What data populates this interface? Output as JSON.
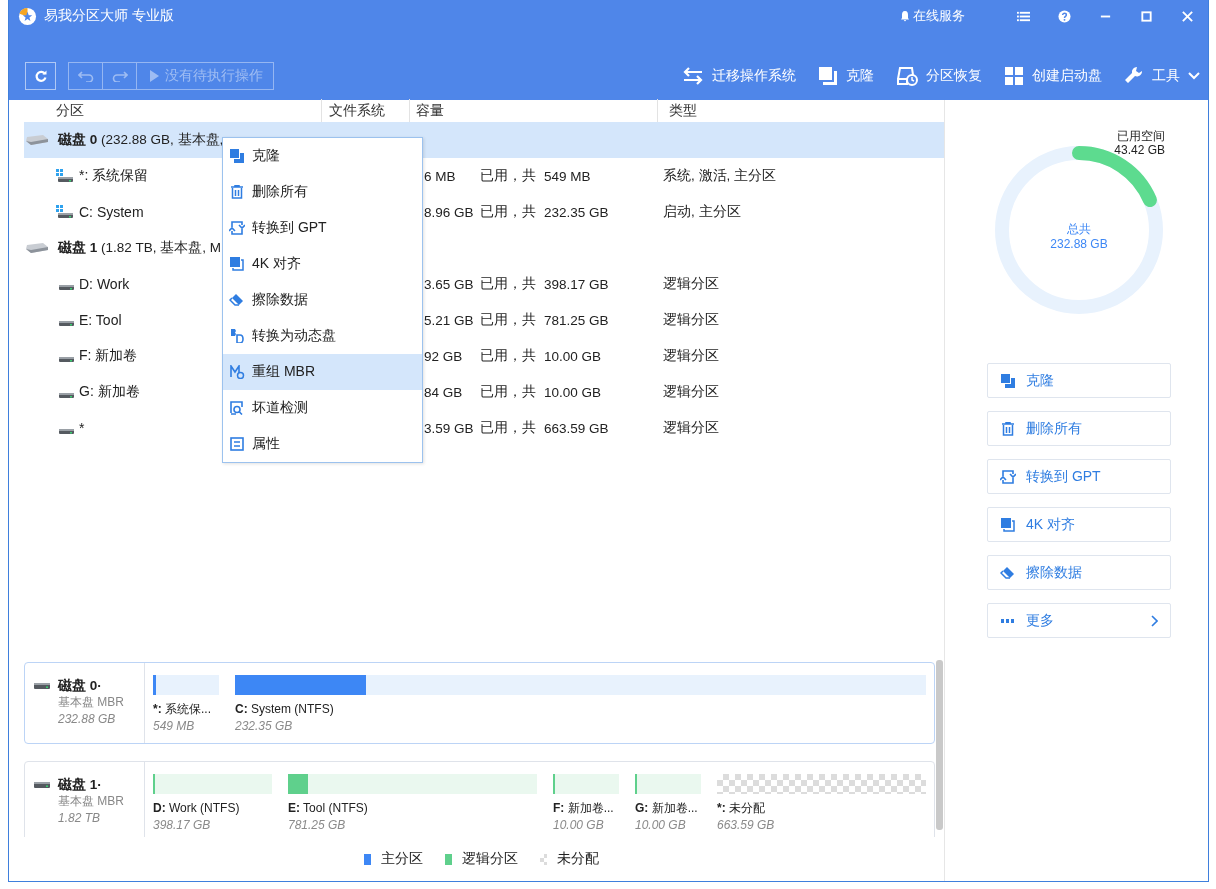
{
  "window": {
    "title": "易我分区大师 专业版",
    "service": "在线服务"
  },
  "toolbar": {
    "undo": {
      "disabled": true
    },
    "redo": {
      "disabled": true
    },
    "pending": {
      "label": "没有待执行操作",
      "disabled": true
    },
    "actions": [
      {
        "kind": "migrate",
        "label": "迁移操作系统"
      },
      {
        "kind": "clone",
        "label": "克隆"
      },
      {
        "kind": "recover",
        "label": "分区恢复"
      },
      {
        "kind": "bootdisk",
        "label": "创建启动盘"
      },
      {
        "kind": "tools",
        "label": "工具"
      }
    ]
  },
  "table": {
    "columns": [
      "分区",
      "文件系统",
      "容量",
      "类型"
    ],
    "rows": [
      {
        "kind": "disk",
        "selected": true,
        "name": "磁盘 0",
        "detail": "(232.88 GB, 基本盘,"
      },
      {
        "kind": "partition",
        "selected": false,
        "system": true,
        "name": "*: 系统保留",
        "used": "6 MB",
        "used_of": "已用，共",
        "total": "549 MB",
        "type": "系统, 激活, 主分区"
      },
      {
        "kind": "partition",
        "selected": false,
        "system": true,
        "name": "C: System",
        "used": "8.96 GB",
        "used_of": "已用，共",
        "total": "232.35 GB",
        "type": "启动, 主分区"
      },
      {
        "kind": "disk",
        "selected": false,
        "name": "磁盘 1",
        "detail": "(1.82 TB, 基本盘, M"
      },
      {
        "kind": "partition",
        "selected": false,
        "system": false,
        "name": "D: Work",
        "used": "3.65 GB",
        "used_of": "已用，共",
        "total": "398.17 GB",
        "type": "逻辑分区"
      },
      {
        "kind": "partition",
        "selected": false,
        "system": false,
        "name": "E: Tool",
        "used": "5.21 GB",
        "used_of": "已用，共",
        "total": "781.25 GB",
        "type": "逻辑分区"
      },
      {
        "kind": "partition",
        "selected": false,
        "system": false,
        "name": "F: 新加卷",
        "used": "92 GB",
        "used_of": "已用，共",
        "total": "10.00 GB",
        "type": "逻辑分区"
      },
      {
        "kind": "partition",
        "selected": false,
        "system": false,
        "name": "G: 新加卷",
        "used": "84 GB",
        "used_of": "已用，共",
        "total": "10.00 GB",
        "type": "逻辑分区"
      },
      {
        "kind": "partition",
        "selected": false,
        "system": false,
        "name": "*",
        "used": "3.59 GB",
        "used_of": "已用，共",
        "total": "663.59 GB",
        "type": "逻辑分区"
      }
    ]
  },
  "context_menu": [
    {
      "kind": "clone",
      "label": "克隆",
      "selected": false
    },
    {
      "kind": "delete",
      "label": "删除所有",
      "selected": false
    },
    {
      "kind": "convert",
      "label": "转换到 GPT",
      "selected": false
    },
    {
      "kind": "align",
      "label": "4K 对齐",
      "selected": false
    },
    {
      "kind": "wipe",
      "label": "擦除数据",
      "selected": false
    },
    {
      "kind": "dynamic",
      "label": "转换为动态盘",
      "selected": false
    },
    {
      "kind": "mbr",
      "label": "重组 MBR",
      "selected": true
    },
    {
      "kind": "surface",
      "label": "坏道检测",
      "selected": false
    },
    {
      "kind": "properties",
      "label": "属性",
      "selected": false
    }
  ],
  "usage": {
    "used_label": "已用空间",
    "used": "43.42 GB",
    "level": 0.186,
    "total_label": "总共",
    "total": "232.88 GB"
  },
  "side_actions": [
    {
      "kind": "clone",
      "label": "克隆"
    },
    {
      "kind": "delete",
      "label": "删除所有"
    },
    {
      "kind": "convert",
      "label": "转换到 GPT"
    },
    {
      "kind": "align",
      "label": "4K 对齐"
    },
    {
      "kind": "wipe",
      "label": "擦除数据"
    },
    {
      "kind": "more",
      "label": "更多"
    }
  ],
  "disk_map": [
    {
      "name": "磁盘 0·",
      "type": "基本盘 MBR",
      "size": "232.88 GB",
      "partitions": [
        {
          "kind": "primary",
          "letter": "*:",
          "name": "系统保...",
          "size": "549 MB",
          "level": 0.05
        },
        {
          "kind": "primary",
          "letter": "C:",
          "name": "System (NTFS)",
          "size": "232.35 GB",
          "level": 0.19
        }
      ]
    },
    {
      "name": "磁盘 1·",
      "type": "基本盘 MBR",
      "size": "1.82 TB",
      "partitions": [
        {
          "kind": "logical",
          "letter": "D:",
          "name": "Work (NTFS)",
          "size": "398.17 GB",
          "level": 0.01
        },
        {
          "kind": "logical",
          "letter": "E:",
          "name": "Tool (NTFS)",
          "size": "781.25 GB",
          "level": 0.08
        },
        {
          "kind": "logical",
          "letter": "F:",
          "name": "新加卷...",
          "size": "10.00 GB",
          "level": 0.02
        },
        {
          "kind": "logical",
          "letter": "G:",
          "name": "新加卷...",
          "size": "10.00 GB",
          "level": 0.02
        },
        {
          "kind": "unallocated",
          "letter": "*:",
          "name": "未分配",
          "size": "663.59 GB"
        }
      ]
    }
  ],
  "legend": [
    {
      "kind": "primary",
      "label": "主分区"
    },
    {
      "kind": "logical",
      "label": "逻辑分区"
    },
    {
      "kind": "unallocated",
      "label": "未分配"
    }
  ]
}
